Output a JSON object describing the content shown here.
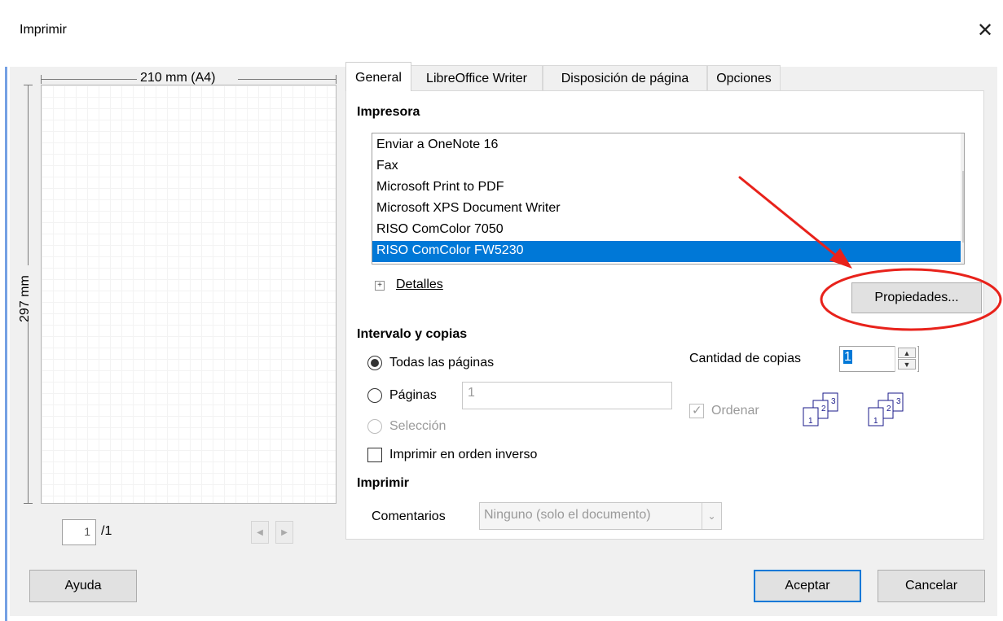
{
  "window": {
    "title": "Imprimir",
    "close_glyph": "✕"
  },
  "preview": {
    "width_label": "210 mm (A4)",
    "height_label": "297 mm",
    "page_number": "1",
    "page_total": "/1"
  },
  "tabs": [
    {
      "label": "General",
      "active": true
    },
    {
      "label": "LibreOffice Writer",
      "active": false
    },
    {
      "label": "Disposición de página",
      "active": false
    },
    {
      "label": "Opciones",
      "active": false
    }
  ],
  "printer": {
    "section_title": "Impresora",
    "items": [
      "Enviar a OneNote 16",
      "Fax",
      "Microsoft Print to PDF",
      "Microsoft XPS Document Writer",
      "RISO ComColor 7050",
      "RISO ComColor FW5230"
    ],
    "selected": "RISO ComColor FW5230",
    "details_label": "Detalles",
    "properties_button": "Propiedades..."
  },
  "range": {
    "section_title": "Intervalo y copias",
    "all_pages_label": "Todas las páginas",
    "pages_label": "Páginas",
    "pages_value": "1",
    "selection_label": "Selección",
    "reverse_label": "Imprimir en orden inverso",
    "copies_label": "Cantidad de copias",
    "copies_value": "1",
    "collate_label": "Ordenar",
    "collate_icons": [
      "collate-on-icon",
      "collate-off-icon"
    ]
  },
  "print_section": {
    "section_title": "Imprimir",
    "comments_label": "Comentarios",
    "comments_value": "Ninguno (solo el documento)"
  },
  "buttons": {
    "help": "Ayuda",
    "ok": "Aceptar",
    "cancel": "Cancelar"
  },
  "colors": {
    "selection": "#0078d7",
    "annotation": "#e8221b"
  }
}
